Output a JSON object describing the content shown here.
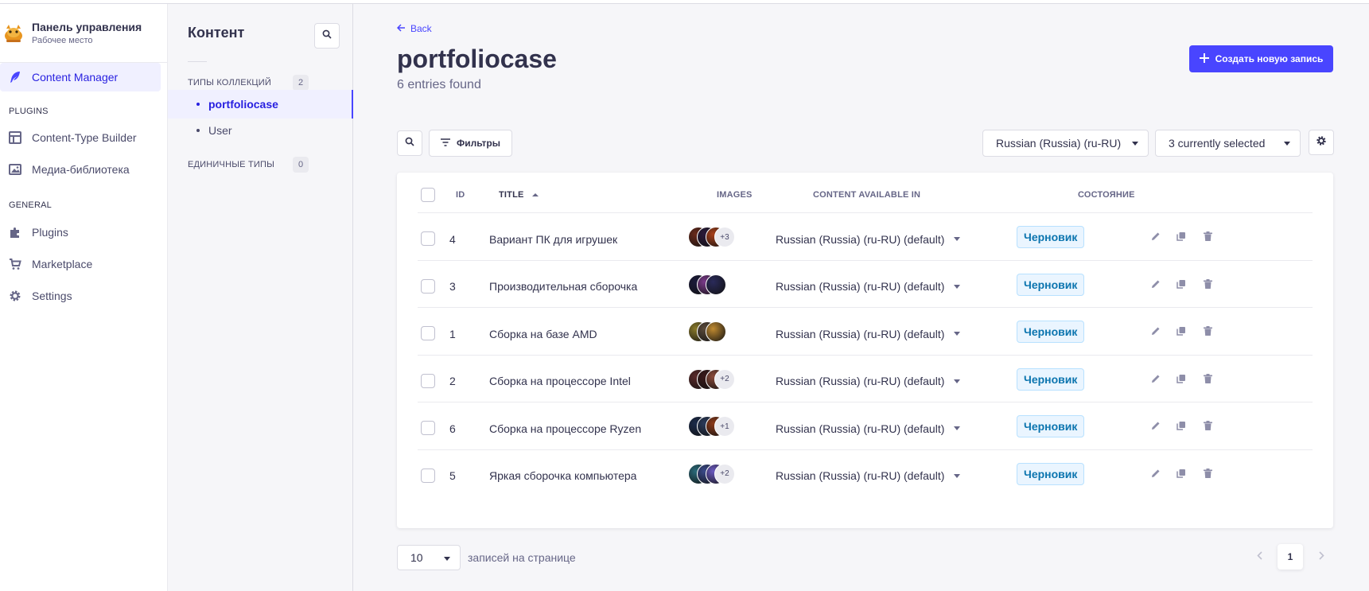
{
  "brand": {
    "title": "Панель управления",
    "subtitle": "Рабочее место"
  },
  "mainnav": {
    "content_manager": "Content Manager",
    "plugins_section": "PLUGINS",
    "content_type_builder": "Content-Type Builder",
    "media_library": "Медиа-библиотека",
    "general_section": "GENERAL",
    "plugins": "Plugins",
    "marketplace": "Marketplace",
    "settings": "Settings"
  },
  "subnav": {
    "title": "Контент",
    "collection_types_label": "ТИПЫ КОЛЛЕКЦИЙ",
    "collection_types_count": "2",
    "collections": [
      "portfoliocase",
      "User"
    ],
    "single_types_label": "ЕДИНИЧНЫЕ ТИПЫ",
    "single_types_count": "0"
  },
  "header": {
    "back_label": "Back",
    "title": "portfoliocase",
    "subtitle": "6 entries found",
    "create_label": "Создать новую запись"
  },
  "toolbar": {
    "filters_label": "Фильтры",
    "locale_value": "Russian (Russia) (ru-RU)",
    "columns_value": "3 currently selected"
  },
  "table": {
    "headers": {
      "id": "ID",
      "title": "TITLE",
      "images": "IMAGES",
      "content_available_in": "CONTENT AVAILABLE IN",
      "state": "СОСТОЯНИЕ"
    },
    "rows": [
      {
        "id": "4",
        "title": "Вариант ПК для игрушек",
        "images_more": "+3",
        "locale": "Russian (Russia) (ru-RU) (default)",
        "status": "Черновик"
      },
      {
        "id": "3",
        "title": "Производительная сборочка",
        "images_more": "",
        "locale": "Russian (Russia) (ru-RU) (default)",
        "status": "Черновик"
      },
      {
        "id": "1",
        "title": "Сборка на базе AMD",
        "images_more": "",
        "locale": "Russian (Russia) (ru-RU) (default)",
        "status": "Черновик"
      },
      {
        "id": "2",
        "title": "Сборка на процессоре Intel",
        "images_more": "+2",
        "locale": "Russian (Russia) (ru-RU) (default)",
        "status": "Черновик"
      },
      {
        "id": "6",
        "title": "Сборка на процессоре Ryzen",
        "images_more": "+1",
        "locale": "Russian (Russia) (ru-RU) (default)",
        "status": "Черновик"
      },
      {
        "id": "5",
        "title": "Яркая сборочка компьютера",
        "images_more": "+2",
        "locale": "Russian (Russia) (ru-RU) (default)",
        "status": "Черновик"
      }
    ]
  },
  "footer": {
    "per_page_value": "10",
    "per_page_label": "записей на странице",
    "current_page": "1"
  },
  "colors": {
    "primary": "#4945ff",
    "status_bg": "#eaf5ff",
    "status_text": "#0c75af"
  }
}
